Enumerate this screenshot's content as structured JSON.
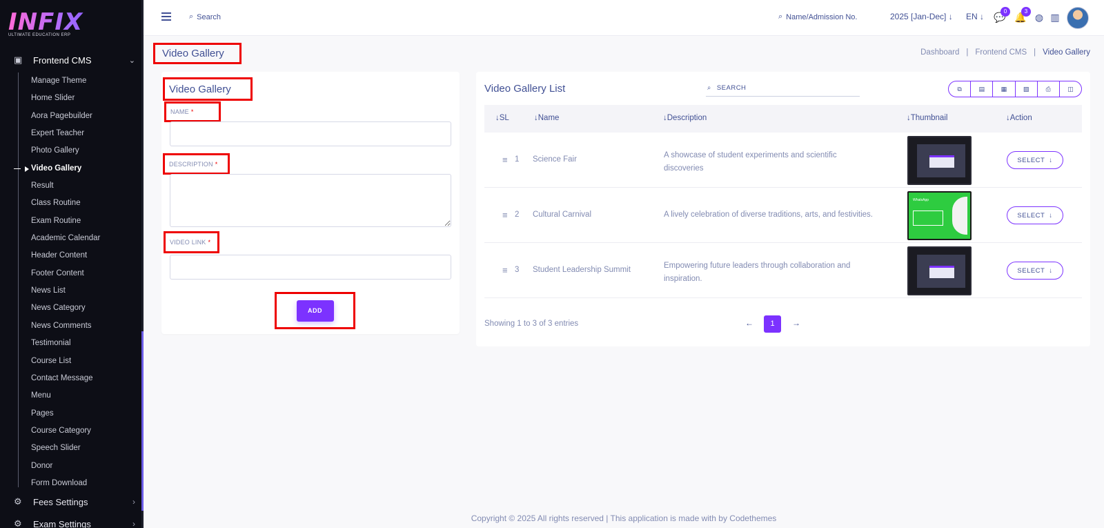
{
  "logo": {
    "text": "INFIX",
    "subtitle": "ULTIMATE EDUCATION ERP"
  },
  "sidebar": {
    "section_label": "Frontend CMS",
    "items": [
      {
        "label": "Manage Theme"
      },
      {
        "label": "Home Slider"
      },
      {
        "label": "Aora Pagebuilder"
      },
      {
        "label": "Expert Teacher"
      },
      {
        "label": "Photo Gallery"
      },
      {
        "label": "Video Gallery"
      },
      {
        "label": "Result"
      },
      {
        "label": "Class Routine"
      },
      {
        "label": "Exam Routine"
      },
      {
        "label": "Academic Calendar"
      },
      {
        "label": "Header Content"
      },
      {
        "label": "Footer Content"
      },
      {
        "label": "News List"
      },
      {
        "label": "News Category"
      },
      {
        "label": "News Comments"
      },
      {
        "label": "Testimonial"
      },
      {
        "label": "Course List"
      },
      {
        "label": "Contact Message"
      },
      {
        "label": "Menu"
      },
      {
        "label": "Pages"
      },
      {
        "label": "Course Category"
      },
      {
        "label": "Speech Slider"
      },
      {
        "label": "Donor"
      },
      {
        "label": "Form Download"
      }
    ],
    "active_item": "Video Gallery",
    "fees_label": "Fees Settings",
    "exam_label": "Exam Settings"
  },
  "topbar": {
    "search_label": "Search",
    "student_search_label": "Name/Admission No.",
    "year": "2025 [Jan-Dec]",
    "lang": "EN",
    "messages_badge": "0",
    "notifications_badge": "3"
  },
  "page": {
    "title": "Video Gallery",
    "breadcrumb": [
      "Dashboard",
      "Frontend CMS",
      "Video Gallery"
    ]
  },
  "form": {
    "title": "Video Gallery",
    "name_label": "NAME",
    "description_label": "DESCRIPTION",
    "video_link_label": "VIDEO LINK",
    "required_mark": "*",
    "name_value": "",
    "description_value": "",
    "video_link_value": "",
    "add_label": "ADD"
  },
  "list": {
    "title": "Video Gallery List",
    "search_label": "SEARCH",
    "columns": [
      "SL",
      "Name",
      "Description",
      "Thumbnail",
      "Action"
    ],
    "rows": [
      {
        "sl": "1",
        "name": "Science Fair",
        "description": "A showcase of student experiments and scientific discoveries",
        "thumbnail": "dark-screenshot",
        "action": "SELECT"
      },
      {
        "sl": "2",
        "name": "Cultural Carnival",
        "description": "A lively celebration of diverse traditions, arts, and festivities.",
        "thumbnail": "green-promo",
        "action": "SELECT"
      },
      {
        "sl": "3",
        "name": "Student Leadership Summit",
        "description": "Empowering future leaders through collaboration and inspiration.",
        "thumbnail": "dark-screenshot",
        "action": "SELECT"
      }
    ],
    "showing": "Showing 1 to 3 of 3 entries",
    "current_page": "1"
  },
  "footer": {
    "text": "Copyright © 2025 All rights reserved | This application is made with by Codethemes"
  },
  "colors": {
    "accent": "#7c32ff",
    "sidebar_bg": "#0d0e16",
    "text": "#415094",
    "annotation_red": "#ee0000"
  }
}
